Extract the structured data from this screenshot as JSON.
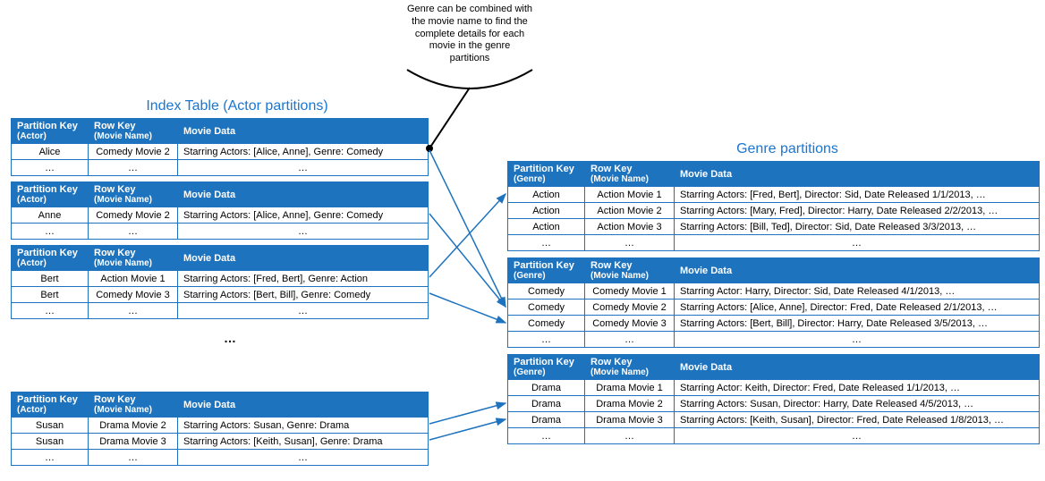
{
  "caption": {
    "line1": "Genre can be combined with",
    "line2": "the movie name to find the",
    "line3": "complete details for each",
    "line4": "movie in the genre",
    "line5": "partitions"
  },
  "left": {
    "title": "Index Table (Actor partitions)",
    "header": {
      "pk_title": "Partition Key",
      "pk_sub": "(Actor)",
      "rk_title": "Row Key",
      "rk_sub": "(Movie Name)",
      "data_title": "Movie Data"
    },
    "tables": [
      {
        "rows": [
          {
            "pk": "Alice",
            "rk": "Comedy Movie 2",
            "data": "Starring Actors: [Alice, Anne], Genre: Comedy"
          }
        ]
      },
      {
        "rows": [
          {
            "pk": "Anne",
            "rk": "Comedy Movie 2",
            "data": "Starring Actors: [Alice, Anne], Genre: Comedy"
          }
        ]
      },
      {
        "rows": [
          {
            "pk": "Bert",
            "rk": "Action Movie 1",
            "data": "Starring Actors: [Fred, Bert], Genre: Action"
          },
          {
            "pk": "Bert",
            "rk": "Comedy Movie 3",
            "data": "Starring Actors: [Bert, Bill], Genre: Comedy"
          }
        ]
      },
      {
        "rows": [
          {
            "pk": "Susan",
            "rk": "Drama Movie 2",
            "data": "Starring Actors: Susan, Genre: Drama"
          },
          {
            "pk": "Susan",
            "rk": "Drama Movie 3",
            "data": "Starring Actors: [Keith, Susan], Genre: Drama"
          }
        ]
      }
    ],
    "row_ellipsis": "…",
    "table_gap_ellipsis": "…"
  },
  "right": {
    "title": "Genre partitions",
    "header": {
      "pk_title": "Partition Key",
      "pk_sub": "(Genre)",
      "rk_title": "Row Key",
      "rk_sub": "(Movie Name)",
      "data_title": "Movie Data"
    },
    "tables": [
      {
        "rows": [
          {
            "pk": "Action",
            "rk": "Action Movie 1",
            "data": "Starring Actors: [Fred, Bert], Director: Sid, Date Released 1/1/2013, …"
          },
          {
            "pk": "Action",
            "rk": "Action Movie 2",
            "data": "Starring Actors: [Mary, Fred], Director: Harry, Date Released 2/2/2013, …"
          },
          {
            "pk": "Action",
            "rk": "Action Movie 3",
            "data": "Starring Actors: [Bill, Ted], Director: Sid, Date Released 3/3/2013, …"
          }
        ]
      },
      {
        "rows": [
          {
            "pk": "Comedy",
            "rk": "Comedy Movie 1",
            "data": "Starring Actor: Harry, Director: Sid, Date Released 4/1/2013, …"
          },
          {
            "pk": "Comedy",
            "rk": "Comedy Movie 2",
            "data": "Starring Actors: [Alice, Anne], Director: Fred, Date Released 2/1/2013, …"
          },
          {
            "pk": "Comedy",
            "rk": "Comedy Movie 3",
            "data": "Starring Actors: [Bert, Bill], Director: Harry, Date Released 3/5/2013, …"
          }
        ]
      },
      {
        "rows": [
          {
            "pk": "Drama",
            "rk": "Drama Movie 1",
            "data": "Starring Actor: Keith, Director: Fred, Date Released 1/1/2013, …"
          },
          {
            "pk": "Drama",
            "rk": "Drama Movie 2",
            "data": "Starring Actors: Susan, Director: Harry, Date Released 4/5/2013, …"
          },
          {
            "pk": "Drama",
            "rk": "Drama Movie 3",
            "data": "Starring Actors: [Keith, Susan], Director: Fred, Date Released 1/8/2013, …"
          }
        ]
      }
    ],
    "row_ellipsis": "…"
  }
}
